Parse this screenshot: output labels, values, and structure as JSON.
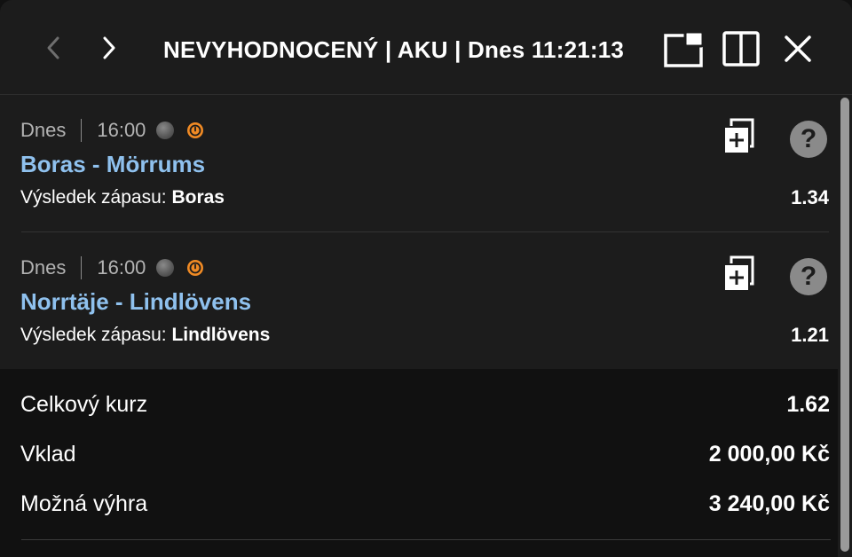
{
  "header": {
    "title": "NEVYHODNOCENÝ | AKU | Dnes 11:21:13",
    "icons": [
      "chevron-left-icon",
      "chevron-right-icon",
      "popout-window-icon",
      "split-view-icon",
      "close-icon"
    ]
  },
  "bets": [
    {
      "day": "Dnes",
      "time": "16:00",
      "match": "Boras - Mörrums",
      "pick_label": "Výsledek zápasu:",
      "pick_value": "Boras",
      "odds": "1.34"
    },
    {
      "day": "Dnes",
      "time": "16:00",
      "match": "Norrtäje - Lindlövens",
      "pick_label": "Výsledek zápasu:",
      "pick_value": "Lindlövens",
      "odds": "1.21"
    }
  ],
  "summary": {
    "total_odds_label": "Celkový kurz",
    "total_odds_value": "1.62",
    "stake_label": "Vklad",
    "stake_value": "2 000,00 Kč",
    "win_label": "Možná výhra",
    "win_value": "3 240,00 Kč"
  },
  "colors": {
    "background": "#1c1c1c",
    "summary_background": "#111111",
    "match_link": "#8fc1ee",
    "live_badge": "#f08a24",
    "muted_text": "#b3b3b3"
  }
}
